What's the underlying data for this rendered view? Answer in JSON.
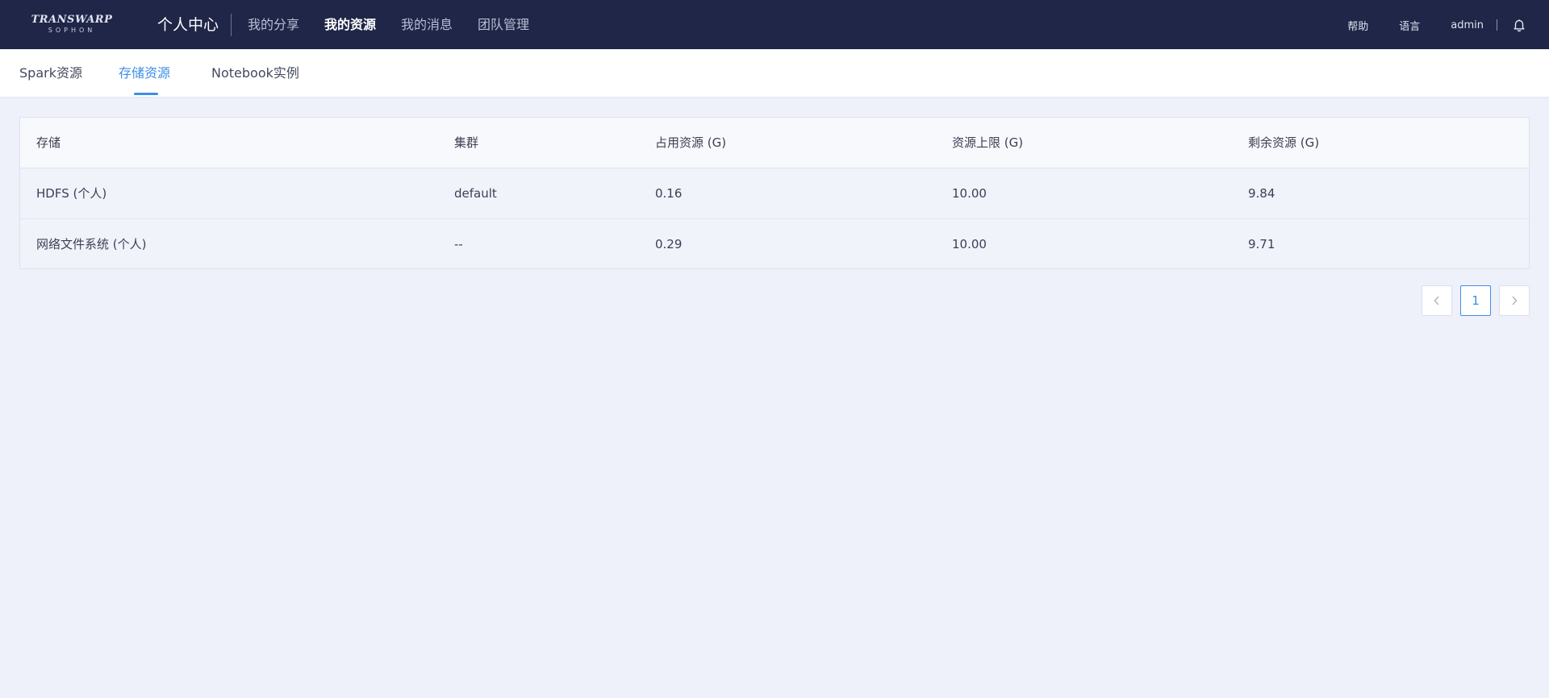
{
  "header": {
    "logo": {
      "brand": "TRANSWARP",
      "sub": "SOPHON"
    },
    "app_title": "个人中心",
    "nav": [
      {
        "label": "我的分享",
        "active": false
      },
      {
        "label": "我的资源",
        "active": true
      },
      {
        "label": "我的消息",
        "active": false
      },
      {
        "label": "团队管理",
        "active": false
      }
    ],
    "help": "帮助",
    "language": "语言",
    "user": "admin",
    "bell_icon": "bell-icon"
  },
  "subtabs": [
    {
      "label": "Spark资源",
      "active": false
    },
    {
      "label": "存储资源",
      "active": true
    },
    {
      "label": "Notebook实例",
      "active": false
    }
  ],
  "table": {
    "columns": [
      "存储",
      "集群",
      "占用资源 (G)",
      "资源上限 (G)",
      "剩余资源 (G)"
    ],
    "rows": [
      [
        "HDFS (个人)",
        "default",
        "0.16",
        "10.00",
        "9.84"
      ],
      [
        "网络文件系统 (个人)",
        "--",
        "0.29",
        "10.00",
        "9.71"
      ]
    ]
  },
  "pagination": {
    "prev_icon": "chevron-left-icon",
    "current_page": "1",
    "next_icon": "chevron-right-icon"
  },
  "colors": {
    "header_bg": "#1f2647",
    "accent": "#3d8ee8",
    "page_bg": "#eef0fa"
  }
}
